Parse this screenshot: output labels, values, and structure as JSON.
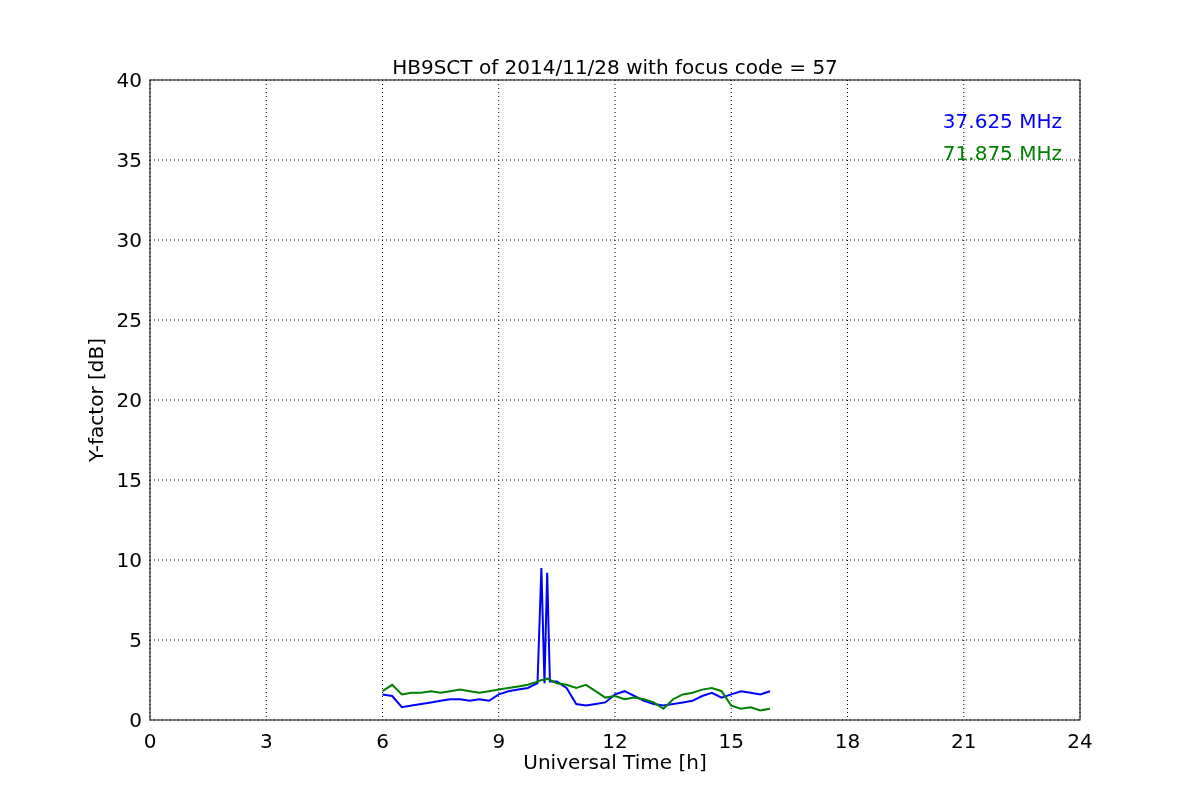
{
  "chart_data": {
    "type": "line",
    "title": "HB9SCT of 2014/11/28 with focus code = 57",
    "xlabel": "Universal Time [h]",
    "ylabel": "Y-factor [dB]",
    "x": [
      6,
      6.25,
      6.5,
      6.75,
      7,
      7.25,
      7.5,
      7.75,
      8,
      8.25,
      8.5,
      8.75,
      9,
      9.25,
      9.5,
      9.75,
      10,
      10.1,
      10.18,
      10.25,
      10.32,
      10.5,
      10.75,
      11,
      11.25,
      11.5,
      11.75,
      12,
      12.25,
      12.5,
      12.75,
      13,
      13.25,
      13.5,
      13.75,
      14,
      14.25,
      14.5,
      14.75,
      15,
      15.25,
      15.5,
      15.75,
      16
    ],
    "series": [
      {
        "name": "37.625 MHz",
        "color": "#0000ff",
        "values": [
          1.6,
          1.5,
          0.8,
          0.9,
          1.0,
          1.1,
          1.2,
          1.3,
          1.3,
          1.2,
          1.3,
          1.2,
          1.6,
          1.8,
          1.9,
          2.0,
          2.3,
          9.5,
          2.3,
          9.2,
          2.4,
          2.4,
          2.0,
          1.0,
          0.9,
          1.0,
          1.1,
          1.6,
          1.8,
          1.5,
          1.2,
          1.0,
          0.9,
          1.0,
          1.1,
          1.2,
          1.5,
          1.7,
          1.4,
          1.6,
          1.8,
          1.7,
          1.6,
          1.8
        ]
      },
      {
        "name": "71.875 MHz",
        "color": "#008000",
        "values": [
          1.8,
          2.2,
          1.6,
          1.7,
          1.7,
          1.8,
          1.7,
          1.8,
          1.9,
          1.8,
          1.7,
          1.8,
          1.9,
          2.0,
          2.1,
          2.2,
          2.4,
          2.5,
          2.5,
          2.6,
          2.5,
          2.3,
          2.2,
          2.0,
          2.2,
          1.8,
          1.4,
          1.5,
          1.3,
          1.4,
          1.3,
          1.1,
          0.7,
          1.3,
          1.6,
          1.7,
          1.9,
          2.0,
          1.8,
          0.9,
          0.7,
          0.8,
          0.6,
          0.7
        ]
      }
    ],
    "xlim": [
      0,
      24
    ],
    "ylim": [
      0,
      40
    ],
    "xticks": [
      0,
      3,
      6,
      9,
      12,
      15,
      18,
      21,
      24
    ],
    "yticks": [
      0,
      5,
      10,
      15,
      20,
      25,
      30,
      35,
      40
    ],
    "grid": true
  }
}
